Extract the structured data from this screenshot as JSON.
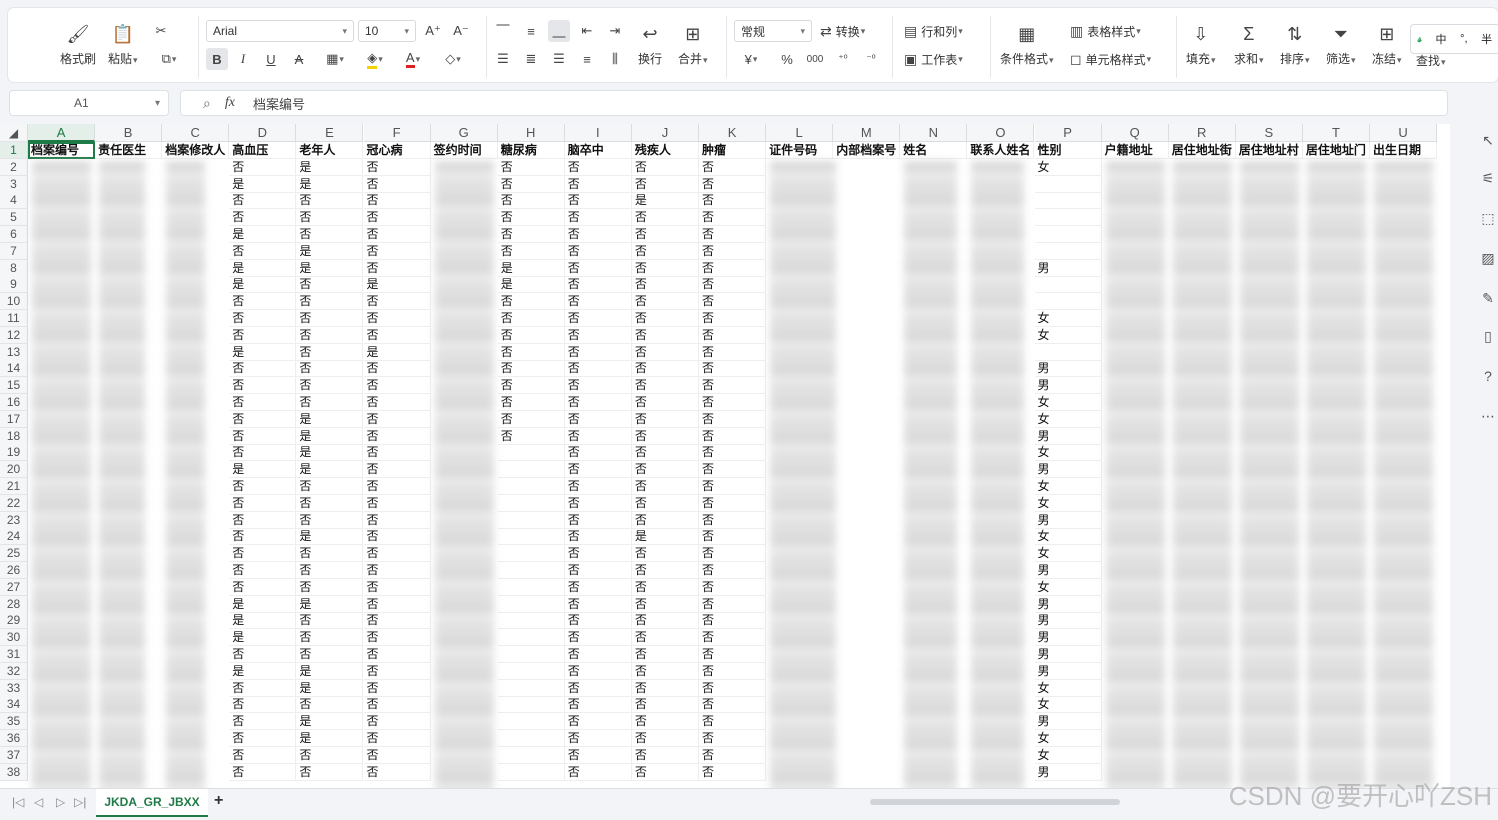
{
  "toolbar": {
    "format_painter": "格式刷",
    "paste": "粘贴",
    "font_name": "Arial",
    "font_size": "10",
    "wrap": "换行",
    "merge": "合并",
    "number_format": "常规",
    "convert": "转换",
    "row_col": "行和列",
    "worksheet": "工作表",
    "cond_format": "条件格式",
    "table_style": "表格样式",
    "cell_style": "单元格样式",
    "fill": "填充",
    "sum": "求和",
    "sort": "排序",
    "filter": "筛选",
    "freeze": "冻结",
    "find": "查找",
    "ime_zh": "中",
    "ime_half": "半"
  },
  "formula_bar": {
    "name_box": "A1",
    "fx": "fx",
    "content": "档案编号"
  },
  "columns": [
    "A",
    "B",
    "C",
    "D",
    "E",
    "F",
    "G",
    "H",
    "I",
    "J",
    "K",
    "L",
    "M",
    "N",
    "O",
    "P",
    "Q",
    "R",
    "S",
    "T",
    "U"
  ],
  "headers": [
    "档案编号",
    "责任医生",
    "档案修改人",
    "高血压",
    "老年人",
    "冠心病",
    "签约时间",
    "糖尿病",
    "脑卒中",
    "残疾人",
    "肿瘤",
    "证件号码",
    "内部档案号",
    "姓名",
    "联系人姓名",
    "性别",
    "户籍地址",
    "居住地址街",
    "居住地址村",
    "居住地址门",
    "出生日期"
  ],
  "rows": [
    {
      "n": "2",
      "D": "否",
      "E": "是",
      "F": "否",
      "H": "否",
      "I": "否",
      "J": "否",
      "K": "否",
      "P": "女"
    },
    {
      "n": "3",
      "D": "是",
      "E": "是",
      "F": "否",
      "H": "否",
      "I": "否",
      "J": "否",
      "K": "否",
      "P": ""
    },
    {
      "n": "4",
      "D": "否",
      "E": "否",
      "F": "否",
      "H": "否",
      "I": "否",
      "J": "是",
      "K": "否",
      "P": ""
    },
    {
      "n": "5",
      "D": "否",
      "E": "否",
      "F": "否",
      "H": "否",
      "I": "否",
      "J": "否",
      "K": "否",
      "P": ""
    },
    {
      "n": "6",
      "D": "是",
      "E": "否",
      "F": "否",
      "H": "否",
      "I": "否",
      "J": "否",
      "K": "否",
      "P": ""
    },
    {
      "n": "7",
      "D": "否",
      "E": "是",
      "F": "否",
      "H": "否",
      "I": "否",
      "J": "否",
      "K": "否",
      "P": ""
    },
    {
      "n": "8",
      "D": "是",
      "E": "是",
      "F": "否",
      "H": "是",
      "I": "否",
      "J": "否",
      "K": "否",
      "P": "男"
    },
    {
      "n": "9",
      "D": "是",
      "E": "否",
      "F": "是",
      "H": "是",
      "I": "否",
      "J": "否",
      "K": "否",
      "P": ""
    },
    {
      "n": "10",
      "D": "否",
      "E": "否",
      "F": "否",
      "H": "否",
      "I": "否",
      "J": "否",
      "K": "否",
      "P": ""
    },
    {
      "n": "11",
      "D": "否",
      "E": "否",
      "F": "否",
      "H": "否",
      "I": "否",
      "J": "否",
      "K": "否",
      "P": "女"
    },
    {
      "n": "12",
      "D": "否",
      "E": "否",
      "F": "否",
      "H": "否",
      "I": "否",
      "J": "否",
      "K": "否",
      "P": "女"
    },
    {
      "n": "13",
      "D": "是",
      "E": "否",
      "F": "是",
      "H": "否",
      "I": "否",
      "J": "否",
      "K": "否",
      "P": ""
    },
    {
      "n": "14",
      "D": "否",
      "E": "否",
      "F": "否",
      "H": "否",
      "I": "否",
      "J": "否",
      "K": "否",
      "P": "男"
    },
    {
      "n": "15",
      "D": "否",
      "E": "否",
      "F": "否",
      "H": "否",
      "I": "否",
      "J": "否",
      "K": "否",
      "P": "男"
    },
    {
      "n": "16",
      "D": "否",
      "E": "否",
      "F": "否",
      "H": "否",
      "I": "否",
      "J": "否",
      "K": "否",
      "P": "女"
    },
    {
      "n": "17",
      "D": "否",
      "E": "是",
      "F": "否",
      "H": "否",
      "I": "否",
      "J": "否",
      "K": "否",
      "P": "女"
    },
    {
      "n": "18",
      "D": "否",
      "E": "是",
      "F": "否",
      "H": "否",
      "I": "否",
      "J": "否",
      "K": "否",
      "P": "男"
    },
    {
      "n": "19",
      "D": "否",
      "E": "是",
      "F": "否",
      "H": "",
      "I": "否",
      "J": "否",
      "K": "否",
      "P": "女"
    },
    {
      "n": "20",
      "D": "是",
      "E": "是",
      "F": "否",
      "H": "",
      "I": "否",
      "J": "否",
      "K": "否",
      "P": "男"
    },
    {
      "n": "21",
      "D": "否",
      "E": "否",
      "F": "否",
      "H": "",
      "I": "否",
      "J": "否",
      "K": "否",
      "P": "女"
    },
    {
      "n": "22",
      "D": "否",
      "E": "否",
      "F": "否",
      "H": "",
      "I": "否",
      "J": "否",
      "K": "否",
      "P": "女"
    },
    {
      "n": "23",
      "D": "否",
      "E": "否",
      "F": "否",
      "H": "",
      "I": "否",
      "J": "否",
      "K": "否",
      "P": "男"
    },
    {
      "n": "24",
      "D": "否",
      "E": "是",
      "F": "否",
      "H": "",
      "I": "否",
      "J": "是",
      "K": "否",
      "P": "女"
    },
    {
      "n": "25",
      "D": "否",
      "E": "否",
      "F": "否",
      "H": "",
      "I": "否",
      "J": "否",
      "K": "否",
      "P": "女"
    },
    {
      "n": "26",
      "D": "否",
      "E": "否",
      "F": "否",
      "H": "",
      "I": "否",
      "J": "否",
      "K": "否",
      "P": "男"
    },
    {
      "n": "27",
      "D": "否",
      "E": "否",
      "F": "否",
      "H": "",
      "I": "否",
      "J": "否",
      "K": "否",
      "P": "女"
    },
    {
      "n": "28",
      "D": "是",
      "E": "是",
      "F": "否",
      "H": "",
      "I": "否",
      "J": "否",
      "K": "否",
      "P": "男"
    },
    {
      "n": "29",
      "D": "是",
      "E": "否",
      "F": "否",
      "H": "",
      "I": "否",
      "J": "否",
      "K": "否",
      "P": "男"
    },
    {
      "n": "30",
      "D": "是",
      "E": "否",
      "F": "否",
      "H": "",
      "I": "否",
      "J": "否",
      "K": "否",
      "P": "男"
    },
    {
      "n": "31",
      "D": "否",
      "E": "否",
      "F": "否",
      "H": "",
      "I": "否",
      "J": "否",
      "K": "否",
      "P": "男"
    },
    {
      "n": "32",
      "D": "是",
      "E": "是",
      "F": "否",
      "H": "",
      "I": "否",
      "J": "否",
      "K": "否",
      "P": "男"
    },
    {
      "n": "33",
      "D": "否",
      "E": "是",
      "F": "否",
      "H": "",
      "I": "否",
      "J": "否",
      "K": "否",
      "P": "女"
    },
    {
      "n": "34",
      "D": "否",
      "E": "否",
      "F": "否",
      "H": "",
      "I": "否",
      "J": "否",
      "K": "否",
      "P": "女"
    },
    {
      "n": "35",
      "D": "否",
      "E": "是",
      "F": "否",
      "H": "",
      "I": "否",
      "J": "否",
      "K": "否",
      "P": "男"
    },
    {
      "n": "36",
      "D": "否",
      "E": "是",
      "F": "否",
      "H": "",
      "I": "否",
      "J": "否",
      "K": "否",
      "P": "女"
    },
    {
      "n": "37",
      "D": "否",
      "E": "否",
      "F": "否",
      "H": "",
      "I": "否",
      "J": "否",
      "K": "否",
      "P": "女"
    },
    {
      "n": "38",
      "D": "否",
      "E": "否",
      "F": "否",
      "H": "",
      "I": "否",
      "J": "否",
      "K": "否",
      "P": "男"
    }
  ],
  "sheet_tab": "JKDA_GR_JBXX",
  "add_sheet": "+",
  "watermark": "CSDN @要开心吖ZSH",
  "accent_color": "#1e7a47"
}
